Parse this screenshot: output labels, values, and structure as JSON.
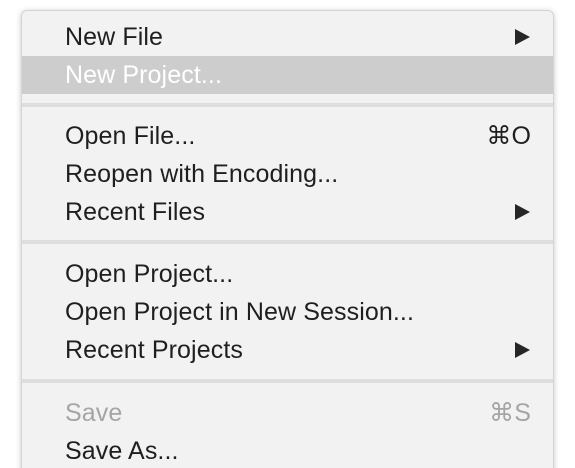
{
  "menu": {
    "items": [
      {
        "label": "New File",
        "shortcut": "",
        "submenu": true,
        "state": "normal"
      },
      {
        "label": "New Project...",
        "shortcut": "",
        "submenu": false,
        "state": "highlighted"
      },
      {
        "label": "Open File...",
        "shortcut": "⌘O",
        "submenu": false,
        "state": "normal"
      },
      {
        "label": "Reopen with Encoding...",
        "shortcut": "",
        "submenu": false,
        "state": "normal"
      },
      {
        "label": "Recent Files",
        "shortcut": "",
        "submenu": true,
        "state": "normal"
      },
      {
        "label": "Open Project...",
        "shortcut": "",
        "submenu": false,
        "state": "normal"
      },
      {
        "label": "Open Project in New Session...",
        "shortcut": "",
        "submenu": false,
        "state": "normal"
      },
      {
        "label": "Recent Projects",
        "shortcut": "",
        "submenu": true,
        "state": "normal"
      },
      {
        "label": "Save",
        "shortcut": "⌘S",
        "submenu": false,
        "state": "disabled"
      },
      {
        "label": "Save As...",
        "shortcut": "",
        "submenu": false,
        "state": "normal"
      }
    ]
  },
  "colors": {
    "menu_background": "#f2f2f2",
    "highlight_background": "#cdcdcd",
    "highlight_text": "#ffffff",
    "text": "#1f1f1f",
    "disabled_text": "#a5a5a5",
    "separator": "#dedede"
  },
  "icons": {
    "submenu": "submenu-arrow-icon"
  }
}
